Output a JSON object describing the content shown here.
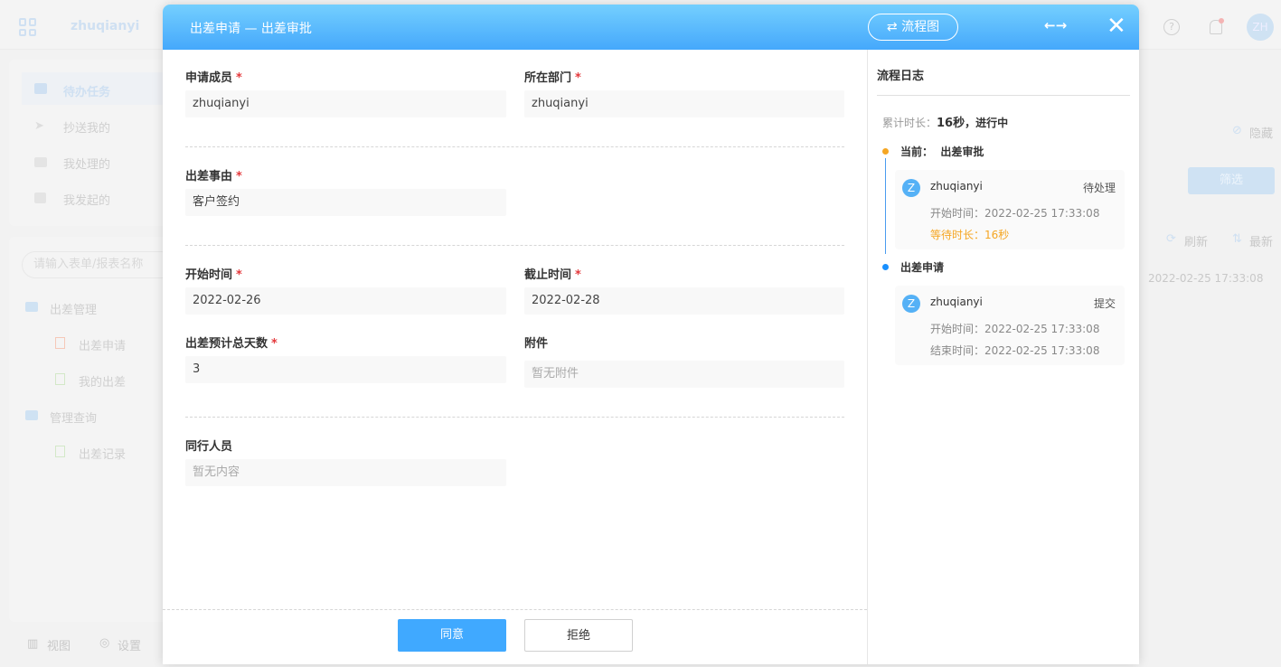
{
  "background": {
    "username": "zhuqianyi",
    "avatar_initials": "ZH",
    "nav": [
      "待办任务",
      "抄送我的",
      "我处理的",
      "我发起的"
    ],
    "search_placeholder": "请输入表单/报表名称",
    "tree": [
      {
        "label": "出差管理",
        "children": [
          "出差申请",
          "我的出差"
        ]
      },
      {
        "label": "管理查询",
        "children": [
          "出差记录"
        ]
      }
    ],
    "footer": {
      "view": "视图",
      "settings": "设置"
    },
    "hide_label": "隐藏",
    "filter_button": "筛选",
    "refresh_label": "刷新",
    "sort_label": "最新",
    "row_time": "2022-02-25 17:33:08"
  },
  "modal": {
    "title": "出差申请 — 出差审批",
    "flowchart_button": "流程图",
    "required_mark": "*",
    "fields": {
      "member": {
        "label": "申请成员",
        "value": "zhuqianyi"
      },
      "department": {
        "label": "所在部门",
        "value": "zhuqianyi"
      },
      "reason": {
        "label": "出差事由",
        "value": "客户签约"
      },
      "start": {
        "label": "开始时间",
        "value": "2022-02-26"
      },
      "end": {
        "label": "截止时间",
        "value": "2022-02-28"
      },
      "days": {
        "label": "出差预计总天数",
        "value": "3"
      },
      "attachment": {
        "label": "附件",
        "placeholder": "暂无附件"
      },
      "companions": {
        "label": "同行人员",
        "placeholder": "暂无内容"
      }
    },
    "agree_button": "同意",
    "reject_button": "拒绝",
    "log": {
      "title": "流程日志",
      "total_label": "累计时长：",
      "total_value": "16秒",
      "status": "，进行中",
      "nodes": [
        {
          "title": "当前：  出差审批",
          "color": "#f5a623",
          "user": "zhuqianyi",
          "action": "待处理",
          "line1": "开始时间：2022-02-25 17:33:08",
          "line2": "等待时长：16秒"
        },
        {
          "title": "出差申请",
          "color": "#1890ff",
          "user": "zhuqianyi",
          "action": "提交",
          "line1": "开始时间：2022-02-25 17:33:08",
          "line2": "结束时间：2022-02-25 17:33:08"
        }
      ],
      "avatar_initial": "Z"
    }
  },
  "colors": {
    "primary": "#40a9ff",
    "required": "#e4393c",
    "warning": "#f5a623"
  }
}
